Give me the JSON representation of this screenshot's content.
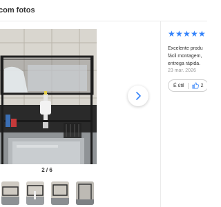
{
  "header": {
    "title": "com fotos"
  },
  "gallery": {
    "counter": "2 / 6",
    "next_icon": "chevron-right-icon"
  },
  "review": {
    "rating": 5,
    "star_icon": "star-icon",
    "text_lines": [
      "Excelente produ",
      "fácil montagem,",
      "entrega rápida."
    ],
    "date": "23 mar. 2026",
    "useful_label": "É útil",
    "useful_icon": "thumbs-up-icon",
    "useful_count": "2"
  },
  "colors": {
    "accent": "#3483fa",
    "text": "#333333",
    "muted": "#999999"
  }
}
